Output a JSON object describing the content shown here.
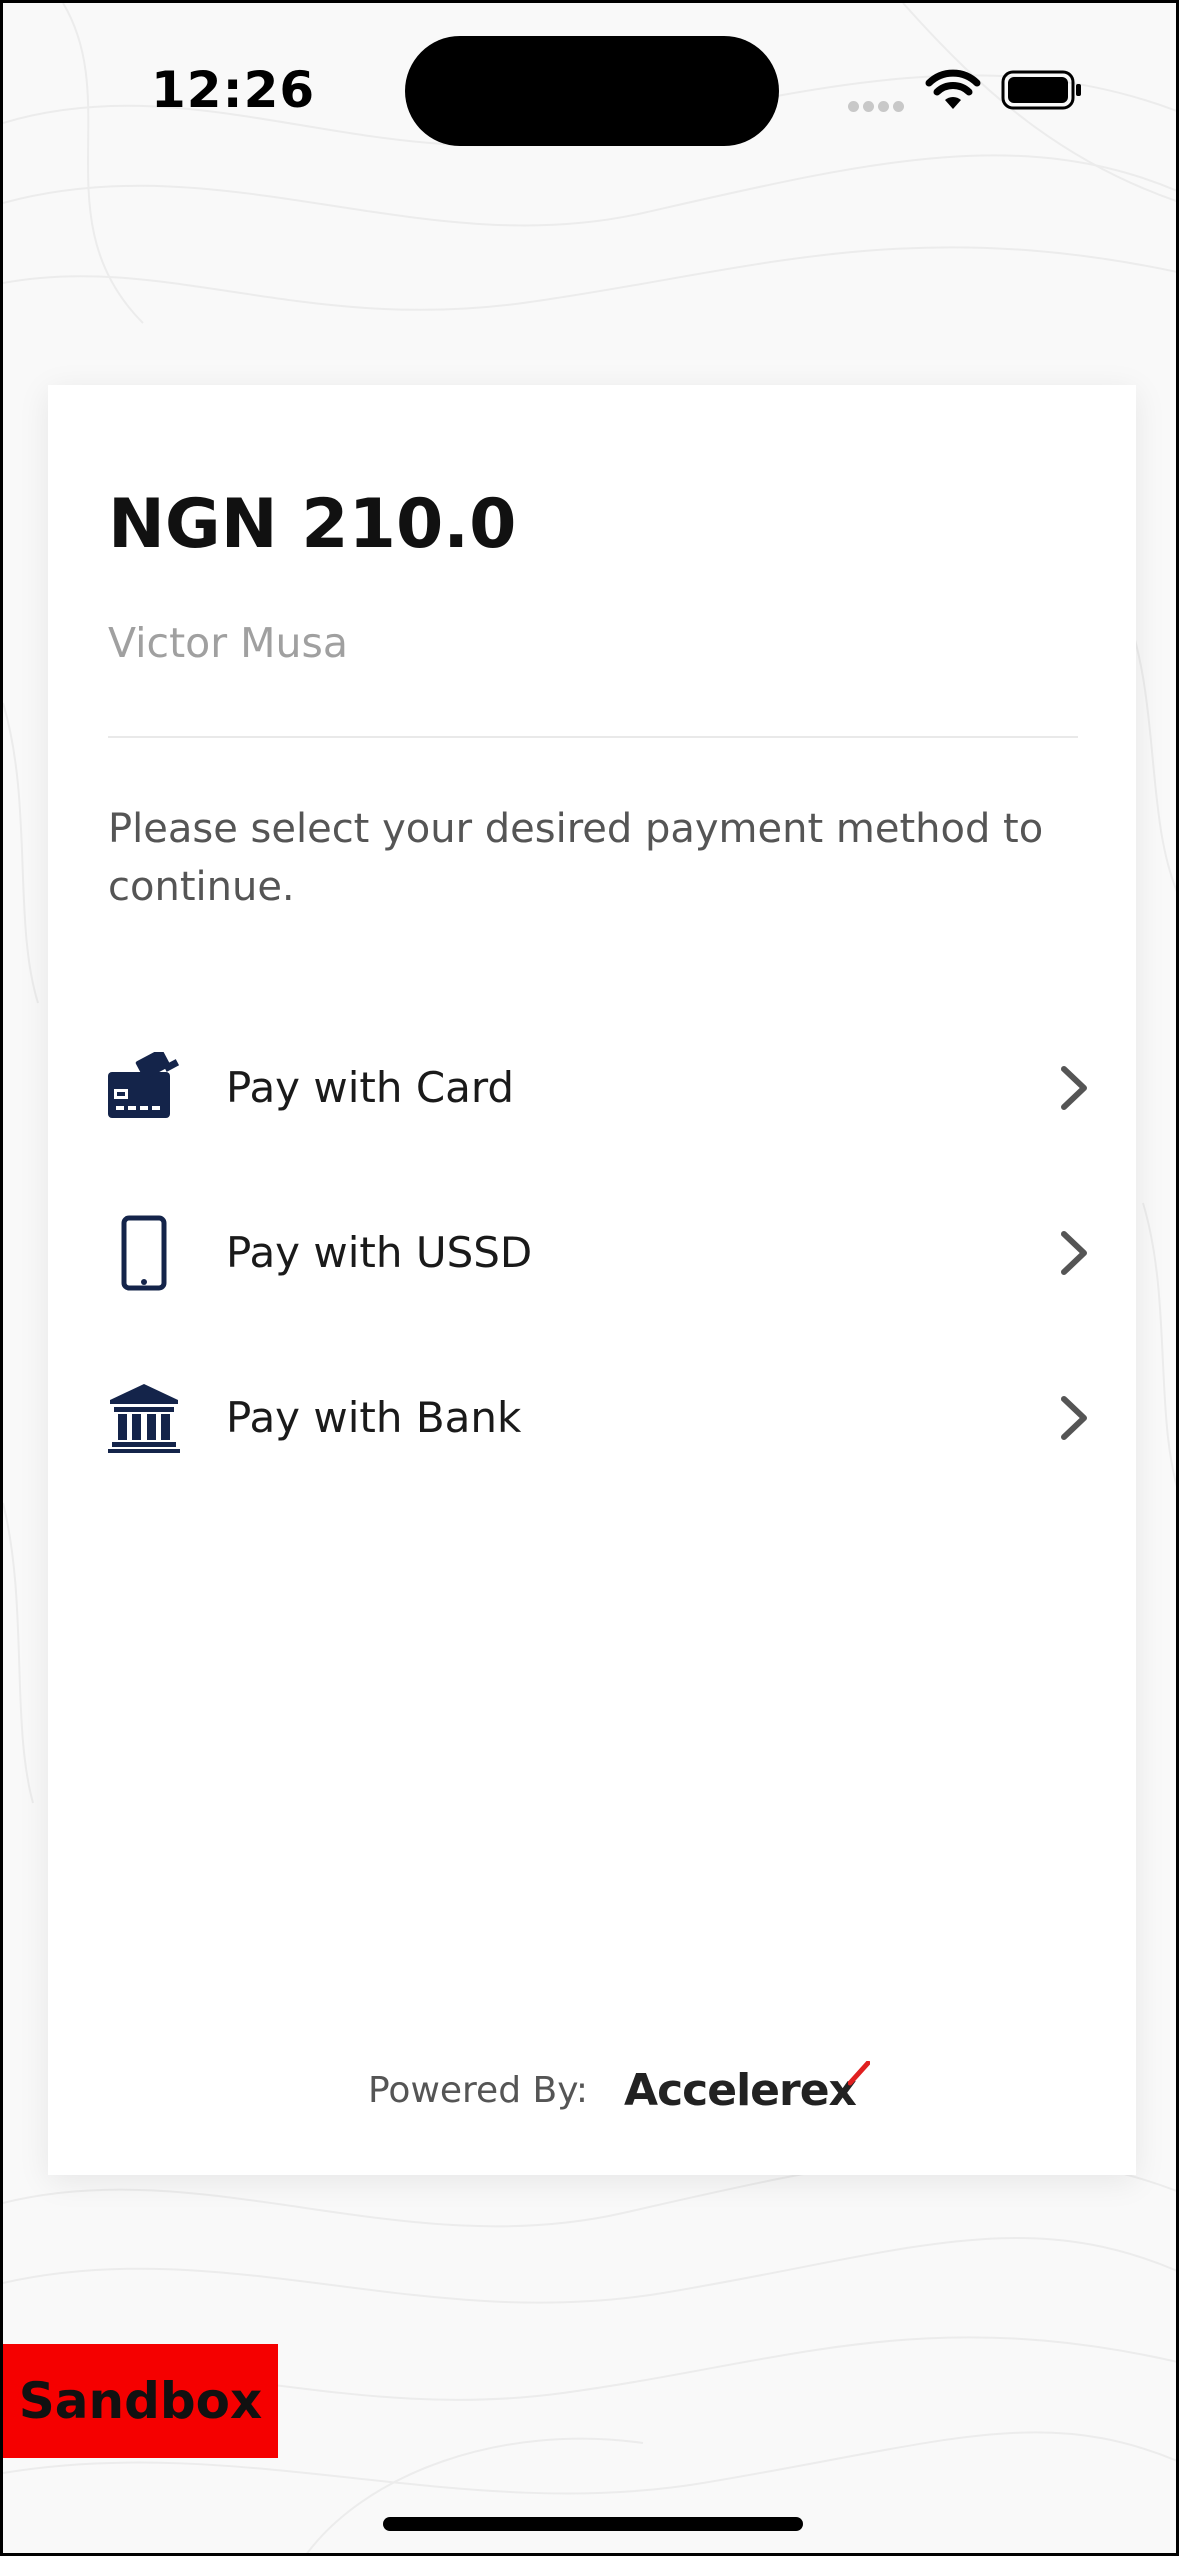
{
  "status_bar": {
    "time": "12:26"
  },
  "payment": {
    "amount": "NGN 210.0",
    "payer_name": "Victor Musa",
    "instruction": "Please select your desired payment method to continue.",
    "options": [
      {
        "label": "Pay with Card",
        "icon": "credit-card-icon"
      },
      {
        "label": "Pay with USSD",
        "icon": "mobile-phone-icon"
      },
      {
        "label": "Pay with Bank",
        "icon": "bank-icon"
      }
    ]
  },
  "footer": {
    "powered_by": "Powered By:",
    "brand": "Accelerex"
  },
  "badge": {
    "sandbox": "Sandbox"
  },
  "colors": {
    "icon_navy": "#14244a",
    "badge_red": "#f50000",
    "muted_text": "#a0a0a0"
  }
}
